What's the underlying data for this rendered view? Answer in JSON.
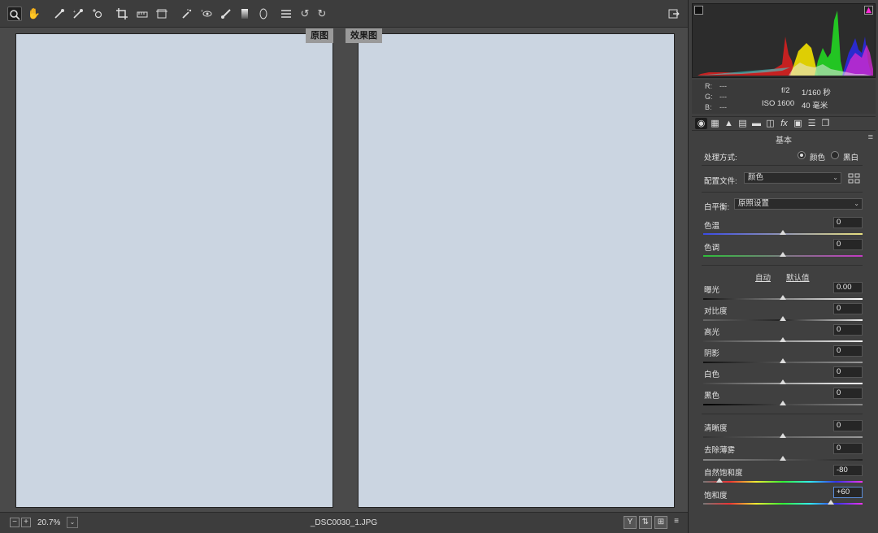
{
  "toolbar": {
    "tools": [
      "zoom-tool",
      "hand-tool",
      "white-balance-tool",
      "color-sampler-tool",
      "targeted-adjustment-tool",
      "crop-tool",
      "straighten-tool",
      "transform-tool",
      "spot-removal-tool",
      "red-eye-tool",
      "adjustment-brush-tool",
      "graduated-filter-tool",
      "radial-filter-tool",
      "preferences",
      "rotate-left",
      "rotate-right",
      "fullscreen-toggle"
    ]
  },
  "views": {
    "before_label": "原图",
    "after_label": "效果图"
  },
  "status": {
    "zoom": "20.7%",
    "filename": "_DSC0030_1.JPG"
  },
  "info": {
    "r_label": "R:",
    "r_value": "---",
    "g_label": "G:",
    "g_value": "---",
    "b_label": "B:",
    "b_value": "---",
    "aperture": "f/2",
    "shutter": "1/160 秒",
    "iso": "ISO 1600",
    "focal": "40 毫米"
  },
  "panel": {
    "section_title": "基本",
    "treatment_label": "处理方式:",
    "treatment_color": "颜色",
    "treatment_bw": "黑白",
    "profile_label": "配置文件:",
    "profile_value": "颜色",
    "wb_label": "白平衡:",
    "wb_value": "原照设置",
    "auto_label": "自动",
    "default_label": "默认值"
  },
  "sliders": [
    {
      "label": "色温",
      "value": "0",
      "level": 0.5
    },
    {
      "label": "色调",
      "value": "0",
      "level": 0.5
    },
    {
      "label": "曝光",
      "value": "0.00",
      "level": 0.5
    },
    {
      "label": "对比度",
      "value": "0",
      "level": 0.5
    },
    {
      "label": "高光",
      "value": "0",
      "level": 0.5
    },
    {
      "label": "阴影",
      "value": "0",
      "level": 0.5
    },
    {
      "label": "白色",
      "value": "0",
      "level": 0.5
    },
    {
      "label": "黑色",
      "value": "0",
      "level": 0.5
    },
    {
      "label": "清晰度",
      "value": "0",
      "level": 0.5
    },
    {
      "label": "去除薄雾",
      "value": "0",
      "level": 0.5
    },
    {
      "label": "自然饱和度",
      "value": "-80",
      "level": 0.1
    },
    {
      "label": "饱和度",
      "value": "+60",
      "level": 0.8
    }
  ],
  "colors": {
    "panel_bg": "#404040",
    "field_focus": "#5a8bd6",
    "before_wall": "#2d2fe0",
    "after_wall": "#a9c2ee"
  }
}
